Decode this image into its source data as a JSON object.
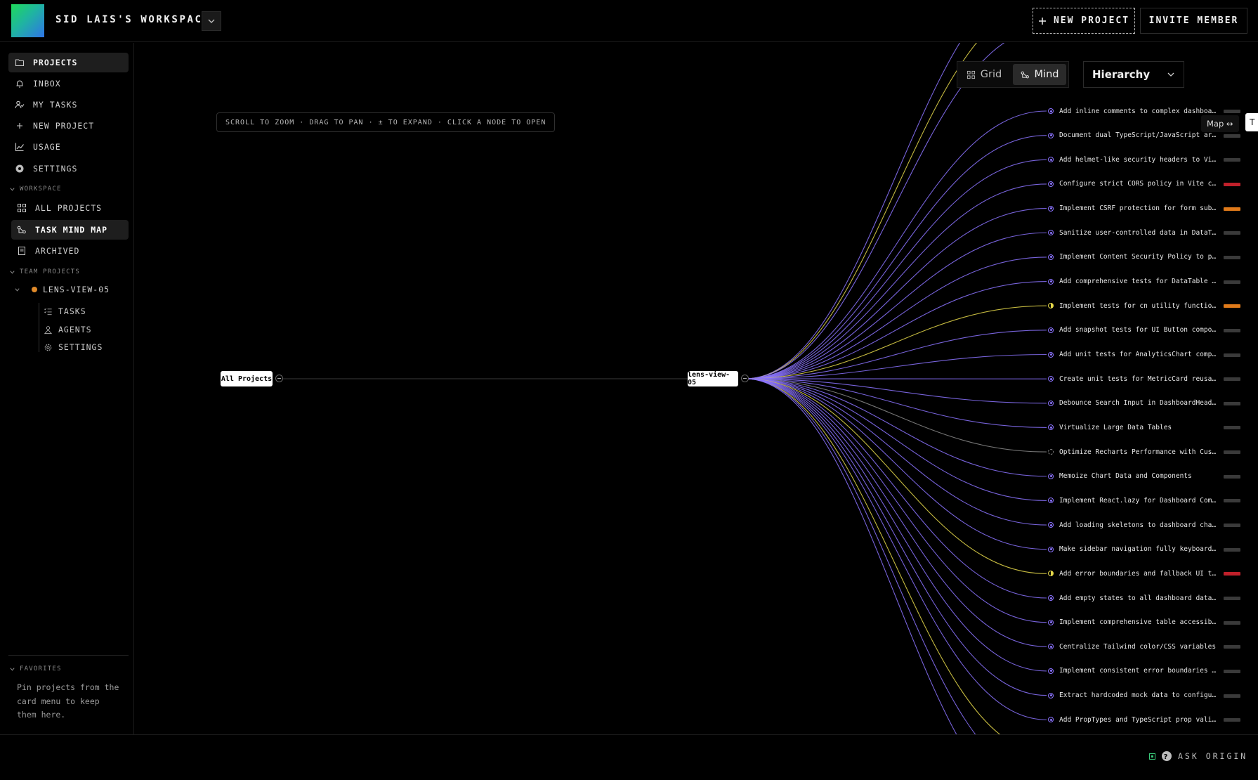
{
  "app": {
    "workspace_title": "SID LAIS'S WORKSPACE",
    "new_project_label": "NEW PROJECT",
    "invite_label": "INVITE MEMBER",
    "ask_label": "ASK ORIGIN"
  },
  "sidebar": {
    "items": [
      {
        "label": "PROJECTS",
        "icon": "folder-icon",
        "active": true
      },
      {
        "label": "INBOX",
        "icon": "bell-icon"
      },
      {
        "label": "MY TASKS",
        "icon": "user-tasks-icon"
      },
      {
        "label": "NEW PROJECT",
        "icon": "plus-icon"
      },
      {
        "label": "USAGE",
        "icon": "chart-line-icon"
      },
      {
        "label": "SETTINGS",
        "icon": "gear-icon"
      }
    ],
    "workspace_heading": "WORKSPACE",
    "workspace_items": [
      {
        "label": "ALL PROJECTS",
        "icon": "grid-icon"
      },
      {
        "label": "TASK MIND MAP",
        "icon": "mind-map-icon",
        "active": true
      },
      {
        "label": "ARCHIVED",
        "icon": "archive-icon"
      }
    ],
    "team_heading": "TEAM PROJECTS",
    "team_project": {
      "label": "LENS-VIEW-05",
      "status_color": "#e08a2a"
    },
    "team_sub_items": [
      {
        "label": "TASKS",
        "icon": "list-icon"
      },
      {
        "label": "AGENTS",
        "icon": "agents-icon"
      },
      {
        "label": "SETTINGS",
        "icon": "gear-icon"
      }
    ],
    "favorites_heading": "FAVORITES",
    "favorites_text": "Pin projects from the card menu to keep them here."
  },
  "toolbar": {
    "view_options": [
      "Grid",
      "Mind"
    ],
    "selected_view": "Mind",
    "layout_select": "Hierarchy",
    "hint": "SCROLL TO ZOOM · DRAG TO PAN · ± TO EXPAND · CLICK A NODE TO OPEN",
    "map_label": "Map ↔",
    "map_tab": "T"
  },
  "mindmap": {
    "root": "All Projects",
    "project": "lens-view-05",
    "colors": {
      "todo": "#8b73ff",
      "in_progress": "#e5d84a",
      "backlog": "#888888"
    },
    "tasks": [
      {
        "title": "Add inline comments to complex dashboard chart comp…",
        "status": "todo",
        "priority_color": "#3a3a3a"
      },
      {
        "title": "Document dual TypeScript/JavaScript architecture",
        "status": "todo",
        "priority_color": "#3a3a3a"
      },
      {
        "title": "Add helmet-like security headers to Vite server",
        "status": "todo",
        "priority_color": "#3a3a3a"
      },
      {
        "title": "Configure strict CORS policy in Vite config",
        "status": "todo",
        "priority_color": "#c0202a"
      },
      {
        "title": "Implement CSRF protection for form submissions",
        "status": "todo",
        "priority_color": "#e07a1a"
      },
      {
        "title": "Sanitize user-controlled data in DataTable and Redd…",
        "status": "todo",
        "priority_color": "#3a3a3a"
      },
      {
        "title": "Implement Content Security Policy to prevent XSS",
        "status": "todo",
        "priority_color": "#3a3a3a"
      },
      {
        "title": "Add comprehensive tests for DataTable component",
        "status": "todo",
        "priority_color": "#3a3a3a"
      },
      {
        "title": "Implement tests for cn utility function in lib/utils…",
        "status": "in_progress",
        "priority_color": "#e07a1a"
      },
      {
        "title": "Add snapshot tests for UI Button component variants",
        "status": "todo",
        "priority_color": "#3a3a3a"
      },
      {
        "title": "Add unit tests for AnalyticsChart component",
        "status": "todo",
        "priority_color": "#3a3a3a"
      },
      {
        "title": "Create unit tests for MetricCard reusable component",
        "status": "todo",
        "priority_color": "#3a3a3a"
      },
      {
        "title": "Debounce Search Input in DashboardHeader",
        "status": "todo",
        "priority_color": "#3a3a3a"
      },
      {
        "title": "Virtualize Large Data Tables",
        "status": "todo",
        "priority_color": "#3a3a3a"
      },
      {
        "title": "Optimize Recharts Performance with Custom Tooltip",
        "status": "backlog",
        "priority_color": "#3a3a3a"
      },
      {
        "title": "Memoize Chart Data and Components",
        "status": "todo",
        "priority_color": "#3a3a3a"
      },
      {
        "title": "Implement React.lazy for Dashboard Components",
        "status": "todo",
        "priority_color": "#3a3a3a"
      },
      {
        "title": "Add loading skeletons to dashboard charts and tables",
        "status": "todo",
        "priority_color": "#3a3a3a"
      },
      {
        "title": "Make sidebar navigation fully keyboard accessible",
        "status": "todo",
        "priority_color": "#3a3a3a"
      },
      {
        "title": "Add error boundaries and fallback UI to dashboard",
        "status": "in_progress",
        "priority_color": "#c0202a"
      },
      {
        "title": "Add empty states to all dashboard data components",
        "status": "todo",
        "priority_color": "#3a3a3a"
      },
      {
        "title": "Implement comprehensive table accessibility for Red…",
        "status": "todo",
        "priority_color": "#3a3a3a"
      },
      {
        "title": "Centralize Tailwind color/CSS variables",
        "status": "todo",
        "priority_color": "#3a3a3a"
      },
      {
        "title": "Implement consistent error boundaries for dashboard",
        "status": "todo",
        "priority_color": "#3a3a3a"
      },
      {
        "title": "Extract hardcoded mock data to configuration",
        "status": "todo",
        "priority_color": "#3a3a3a"
      },
      {
        "title": "Add PropTypes and TypeScript prop validation",
        "status": "todo",
        "priority_color": "#3a3a3a"
      }
    ]
  }
}
